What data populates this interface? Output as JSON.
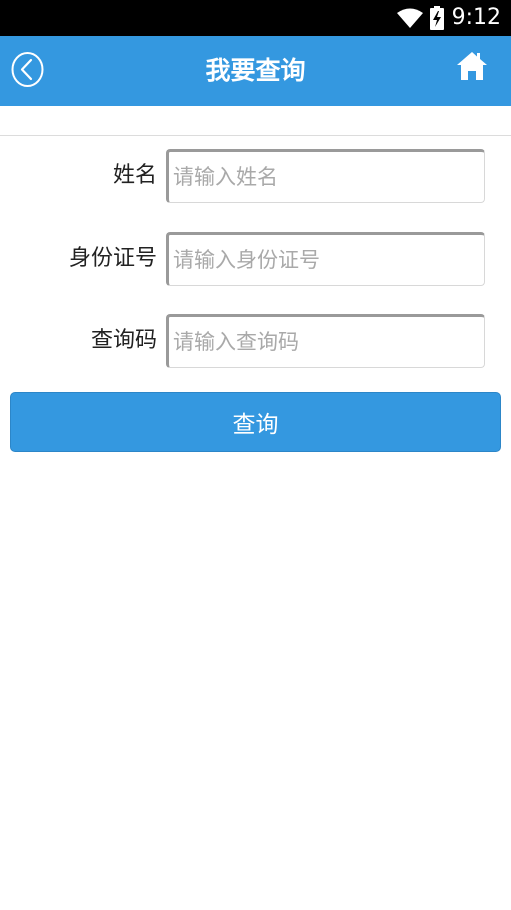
{
  "status_bar": {
    "time": "9:12",
    "icons": [
      "wifi-icon",
      "battery-charging-icon"
    ]
  },
  "header": {
    "title": "我要查询",
    "back_icon": "back-circle-icon",
    "home_icon": "home-icon"
  },
  "form": {
    "fields": [
      {
        "label": "姓名",
        "placeholder": "请输入姓名",
        "value": ""
      },
      {
        "label": "身份证号",
        "placeholder": "请输入身份证号",
        "value": ""
      },
      {
        "label": "查询码",
        "placeholder": "请输入查询码",
        "value": ""
      }
    ],
    "submit_label": "查询"
  },
  "colors": {
    "accent": "#3498e0",
    "status_bar": "#000000",
    "background": "#ffffff",
    "placeholder": "#a9a9a9"
  }
}
